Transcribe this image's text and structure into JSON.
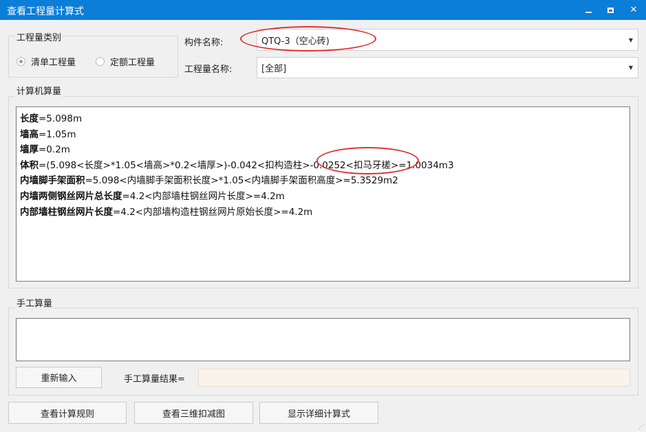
{
  "window": {
    "title": "查看工程量计算式",
    "minimize_icon": "minimize-icon",
    "maximize_icon": "maximize-icon",
    "close_label": "✕"
  },
  "category": {
    "legend": "工程量类别",
    "options": [
      "清单工程量",
      "定额工程量"
    ],
    "selected": "清单工程量"
  },
  "component_name": {
    "label": "构件名称:",
    "value": "QTQ-3（空心砖)"
  },
  "quantity_name": {
    "label": "工程量名称:",
    "value": "[全部]"
  },
  "computer_calc": {
    "legend": "计算机算量",
    "lines": [
      {
        "name": "长度",
        "expr": "=5.098m"
      },
      {
        "name": "墙高",
        "expr": "=1.05m"
      },
      {
        "name": "墙厚",
        "expr": "=0.2m"
      },
      {
        "name": "体积",
        "expr": "=(5.098<长度>*1.05<墙高>*0.2<墙厚>)-0.042<扣构造柱>-0.0252<扣马牙槎>=1.0034m3"
      },
      {
        "name": "内墙脚手架面积",
        "expr": "=5.098<内墙脚手架面积长度>*1.05<内墙脚手架面积高度>=5.3529m2"
      },
      {
        "name": "内墙两侧钢丝网片总长度",
        "expr": "=4.2<内部墙柱钢丝网片长度>=4.2m"
      },
      {
        "name": "内部墙柱钢丝网片长度",
        "expr": "=4.2<内部墙构造柱钢丝网片原始长度>=4.2m"
      }
    ]
  },
  "manual_calc": {
    "legend": "手工算量",
    "input_value": "",
    "reenter_button": "重新输入",
    "result_label": "手工算量结果=",
    "result_value": ""
  },
  "bottom_buttons": {
    "view_rules": "查看计算规则",
    "view_3d": "查看三维扣减图",
    "show_detail": "显示详细计算式"
  },
  "annotations": {
    "color": "#e03131"
  }
}
